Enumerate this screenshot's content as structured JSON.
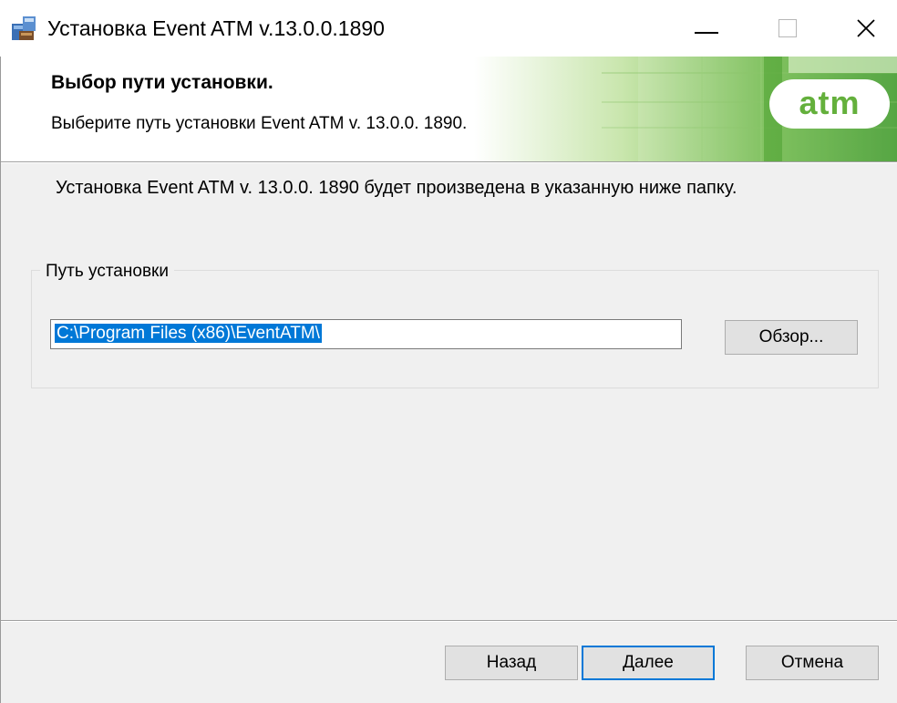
{
  "window": {
    "title": "Установка Event ATM v.13.0.0.1890",
    "controls": {
      "minimize": "minimize",
      "maximize": "maximize",
      "close": "×"
    }
  },
  "header": {
    "title": "Выбор пути установки.",
    "subtitle": "Выберите путь установки Event ATM v. 13.0.0. 1890.",
    "logo_text": "atm",
    "logo_color": "#64b03c"
  },
  "body": {
    "description": "Установка Event ATM v. 13.0.0. 1890 будет произведена в указанную ниже папку.",
    "group_label": "Путь установки",
    "path_value": "C:\\Program Files (x86)\\EventATM\\",
    "browse_label": "Обзор..."
  },
  "footer": {
    "back_label": "Назад",
    "next_label": "Далее",
    "cancel_label": "Отмена"
  },
  "colors": {
    "accent": "#0078d7",
    "window_bg": "#f0f0f0"
  },
  "icons": {
    "app": "installer-package-icon",
    "minimize": "minimize-icon",
    "maximize": "maximize-icon",
    "close": "close-icon"
  }
}
